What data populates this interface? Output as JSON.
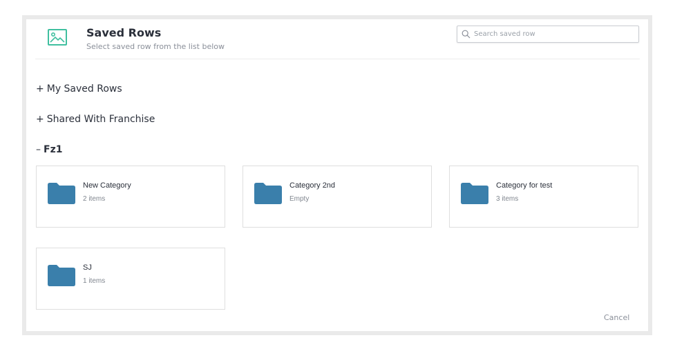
{
  "header": {
    "icon": "image-icon",
    "title": "Saved Rows",
    "subtitle": "Select saved row from the list below",
    "accent": "#3fbf9f"
  },
  "search": {
    "placeholder": "Search saved row",
    "value": ""
  },
  "sections": [
    {
      "sign": "+",
      "label": "My Saved Rows",
      "expanded": false
    },
    {
      "sign": "+",
      "label": "Shared With Franchise",
      "expanded": false
    },
    {
      "sign": "–",
      "label": "Fz1",
      "expanded": true
    }
  ],
  "folders": [
    {
      "name": "New Category",
      "count": "2 items"
    },
    {
      "name": "Category 2nd",
      "count": "Empty"
    },
    {
      "name": "Category for test",
      "count": "3 items"
    },
    {
      "name": "SJ",
      "count": "1 items"
    }
  ],
  "folder_color": "#3a7fab",
  "footer": {
    "cancel_label": "Cancel"
  }
}
